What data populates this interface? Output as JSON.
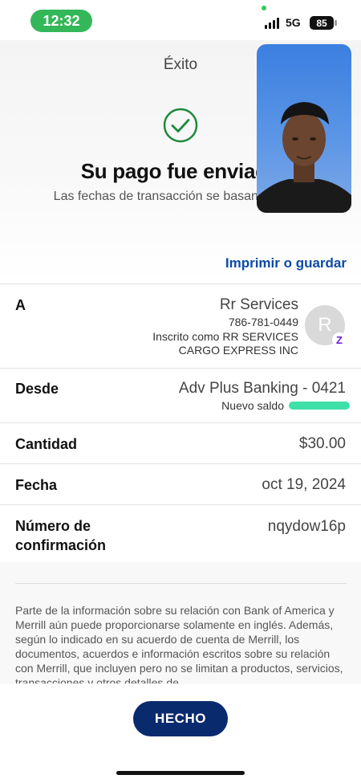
{
  "status_bar": {
    "time": "12:32",
    "network": "5G",
    "battery": "85"
  },
  "header": {
    "title": "Éxito",
    "headline": "Su pago fue enviado",
    "subline": "Las fechas de transacción se basan en este."
  },
  "print_link": "Imprimir o guardar",
  "recipient": {
    "label": "A",
    "name": "Rr Services",
    "phone": "786-781-0449",
    "enrolled_line1": "Inscrito como RR SERVICES",
    "enrolled_line2": "CARGO EXPRESS INC",
    "avatar_initial": "R",
    "badge": "Z"
  },
  "from": {
    "label": "Desde",
    "account": "Adv Plus Banking - 0421",
    "new_balance_label": "Nuevo saldo"
  },
  "amount": {
    "label": "Cantidad",
    "value": "$30.00"
  },
  "date": {
    "label": "Fecha",
    "value": "oct 19, 2024"
  },
  "confirmation": {
    "label_line1": "Número de",
    "label_line2": "confirmación",
    "value": "nqydow16p"
  },
  "disclosure": "Parte de la información sobre su relación con Bank of America y Merrill aún puede proporcionarse solamente en inglés. Además, según lo indicado en su acuerdo de cuenta de Merrill, los documentos, acuerdos e información escritos sobre su relación con Merrill, que incluyen pero no se limitan a productos, servicios, transacciones y otros detalles de",
  "done_button": "HECHO",
  "colors": {
    "accent": "#0a2a6e",
    "link": "#0b4aa6",
    "success": "#1e8a3c",
    "time_pill": "#34b759"
  }
}
